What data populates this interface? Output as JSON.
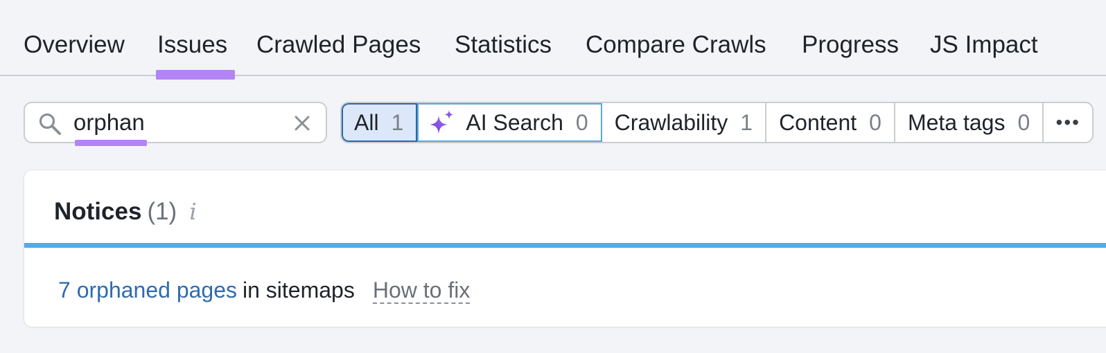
{
  "tabs": [
    {
      "label": "Overview",
      "active": false
    },
    {
      "label": "Issues",
      "active": true
    },
    {
      "label": "Crawled Pages",
      "active": false
    },
    {
      "label": "Statistics",
      "active": false
    },
    {
      "label": "Compare Crawls",
      "active": false
    },
    {
      "label": "Progress",
      "active": false
    },
    {
      "label": "JS Impact",
      "active": false
    }
  ],
  "search": {
    "value": "orphan",
    "icon": "search-icon",
    "clear_icon": "close-icon"
  },
  "filters": [
    {
      "label": "All",
      "count": "1",
      "selected": true
    },
    {
      "label": "AI Search",
      "count": "0",
      "icon": "sparkle-icon"
    },
    {
      "label": "Crawlability",
      "count": "1"
    },
    {
      "label": "Content",
      "count": "0"
    },
    {
      "label": "Meta tags",
      "count": "0"
    }
  ],
  "more_label": "•••",
  "notices": {
    "title": "Notices",
    "count": "(1)",
    "info_glyph": "i",
    "issue": {
      "link_text": "7 orphaned pages",
      "rest_text": "in sitemaps",
      "fix_text": "How to fix"
    }
  },
  "colors": {
    "accent_underline": "#b384f5",
    "active_chip_bg": "#dce8fa",
    "active_chip_border": "#2d66a8",
    "notices_bar": "#57a9ec",
    "link": "#2f6bb0",
    "page_bg": "#f3f4f8"
  }
}
